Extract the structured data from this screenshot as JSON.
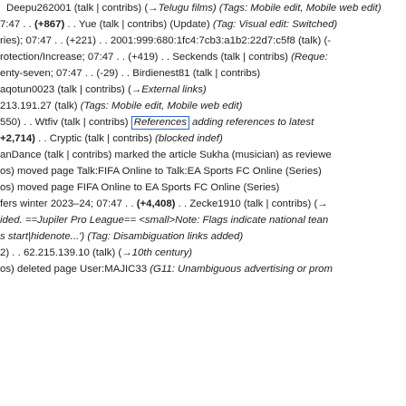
{
  "recent_changes": {
    "lines": [
      {
        "indent": true,
        "a": "Deepu262001 (talk | contribs) (→",
        "a_it": "Telugu films) (Tags: Mobile edit, Mobile web edit)",
        "b": ""
      },
      {
        "indent": false,
        "a": "7:47 . . ",
        "bold": "(+867)",
        "c": " . . Yue (talk | contribs) (Update) ",
        "c_it": "(Tag: Visual edit: Switched)"
      },
      {
        "indent": false,
        "a": "ries); 07:47 . . (+221) . . 2001:999:680:1fc4:7cb3:a1b2:22d7:c5f8 (talk) (-",
        "b": ""
      },
      {
        "indent": false,
        "a": "rotection/Increase; 07:47 . . (+419) . . Seckends (talk | contribs) ",
        "a_it": "(Reque:",
        "b": ""
      },
      {
        "indent": false,
        "a": "enty-seven; 07:47 . . (-29) . . Birdienest81 (talk | contribs)",
        "b": ""
      },
      {
        "indent": false,
        "a": "aqotun0023 (talk | contribs) (→",
        "a_it": "External links)",
        "b": ""
      },
      {
        "indent": false,
        "a": "213.191.27 (talk) ",
        "a_it": "(Tags: Mobile edit, Mobile web edit)",
        "b": ""
      },
      {
        "indent": false,
        "a": "550) . . Wtfiv (talk | contribs) ",
        "boxed": "References",
        "c_it": "adding references to latest",
        "c": ""
      },
      {
        "indent": false,
        "bold": "+2,714)",
        "c": " . . Cryptic (talk | contribs) ",
        "c_it": "(blocked indef)"
      },
      {
        "indent": false,
        "a": "anDance (talk | contribs) marked the article Sukha (musician) as reviewe",
        "b": ""
      },
      {
        "indent": false,
        "a": "os) moved page Talk:FIFA Online to Talk:EA Sports FC Online (Series)",
        "b": ""
      },
      {
        "indent": false,
        "a": "os) moved page FIFA Online to EA Sports FC Online (Series)",
        "b": ""
      },
      {
        "indent": false,
        "a": "fers winter 2023–24; 07:47 . . ",
        "bold": "(+4,408)",
        "c": " . . Zecke1910 (talk | contribs) (→",
        "c_it": ""
      },
      {
        "indent": false,
        "a": "",
        "a_it": "ided. ==Jupiler Pro League== <small>Note: Flags indicate national tean",
        "b": ""
      },
      {
        "indent": false,
        "a": "",
        "a_it": "s start|hidenote...')",
        "b": " ",
        "c_it": "(Tag: Disambiguation links added)"
      },
      {
        "indent": false,
        "a": "2) . . 62.215.139.10 (talk) (→",
        "a_it": "10th century)",
        "b": ""
      },
      {
        "indent": false,
        "a": "os) deleted page User:MAJIC33 ",
        "a_it": "(G11: Unambiguous advertising or prom",
        "b": ""
      }
    ]
  }
}
